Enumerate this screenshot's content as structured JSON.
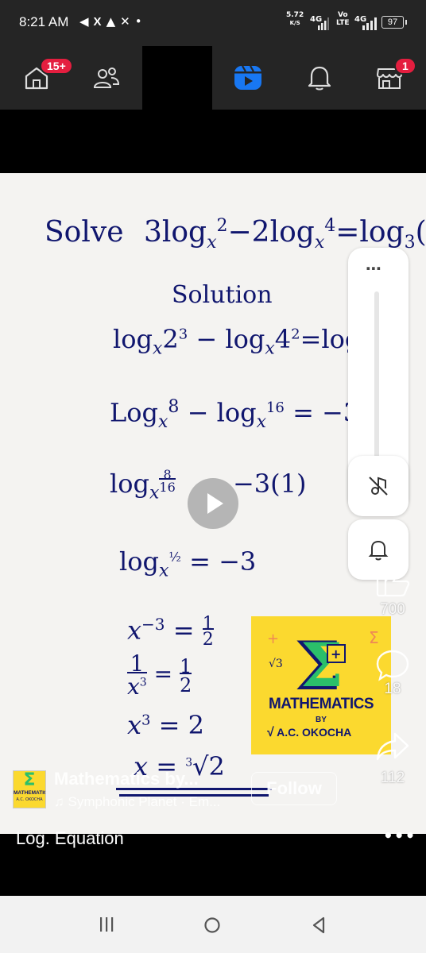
{
  "status_bar": {
    "time": "8:21 AM",
    "left_icons": [
      "telegram-icon",
      "x-icon",
      "notification-icon",
      "missed-call-icon",
      "dot-icon"
    ],
    "net_speed_value": "5.72",
    "net_speed_unit": "K/S",
    "sim1": "4G",
    "volte_top": "Vo",
    "volte_bottom": "LTE",
    "sim2": "4G",
    "battery": "97"
  },
  "top_nav": {
    "home_badge": "15+",
    "marketplace_badge": "1",
    "items": [
      "home-icon",
      "friends-icon",
      "video-icon",
      "notifications-icon",
      "marketplace-icon"
    ]
  },
  "video_content": {
    "problem_word": "Solve",
    "problem": "3log",
    "solution_heading": "Solution"
  },
  "side_buttons": {
    "more": "⋯",
    "mute": "mute-icon",
    "bell": "bell-icon"
  },
  "logo": {
    "title": "MATHEMATICS",
    "by": "BY",
    "author": "A.C. OKOCHA"
  },
  "actions": {
    "likes": "700",
    "comments": "18",
    "shares": "112"
  },
  "post": {
    "author": "Mathematics by...",
    "music": "Symphonic Planet · Em...",
    "follow_label": "Follow",
    "caption": "Log. Equation",
    "avatar_title": "MATHEMATICS",
    "avatar_author": "A.C. OKOCHA"
  },
  "colors": {
    "badge": "#e41e3f",
    "active_tab": "#1877f2",
    "math_ink": "#10166e",
    "logo_bg": "#fbd92f"
  }
}
